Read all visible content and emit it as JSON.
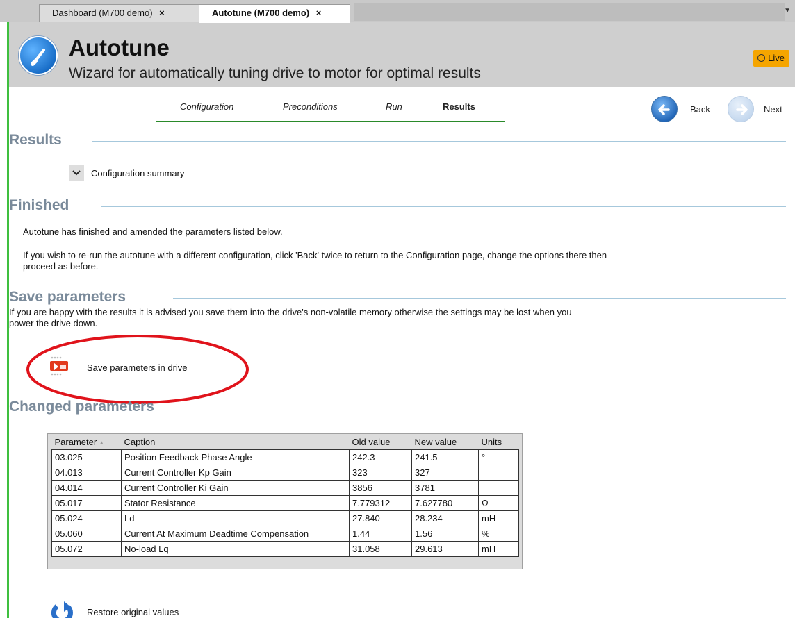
{
  "tabs": [
    {
      "label": "Dashboard (M700 demo)",
      "close": "×",
      "active": false
    },
    {
      "label": "Autotune (M700 demo)",
      "close": "×",
      "active": true
    }
  ],
  "header": {
    "title": "Autotune",
    "subtitle": "Wizard for automatically tuning drive to motor for optimal results",
    "live_label": "Live",
    "live_color": "#f5a500"
  },
  "wizard": {
    "steps": [
      "Configuration",
      "Preconditions",
      "Run",
      "Results"
    ],
    "current_step": "Results",
    "back_label": "Back",
    "next_label": "Next"
  },
  "results": {
    "heading": "Results",
    "config_summary_label": "Configuration summary"
  },
  "finished": {
    "heading": "Finished",
    "line1": "Autotune has finished and amended the parameters listed below.",
    "line2a": "If you wish to re-run the autotune with a different configuration, click 'Back' twice to return to the Configuration page, change the options there then",
    "line2b": "proceed as before."
  },
  "save": {
    "heading": "Save parameters",
    "desc_a": "If you are happy with the results it is advised you save them into the drive's non-volatile memory otherwise the settings may be lost when you",
    "desc_b": "power the drive down.",
    "button_label": "Save parameters in drive",
    "highlight_color": "#e0131b"
  },
  "changed": {
    "heading": "Changed parameters",
    "columns": [
      "Parameter",
      "Caption",
      "Old value",
      "New value",
      "Units"
    ],
    "rows": [
      [
        "03.025",
        "Position Feedback Phase Angle",
        "242.3",
        "241.5",
        "°"
      ],
      [
        "04.013",
        "Current Controller Kp Gain",
        "323",
        "327",
        ""
      ],
      [
        "04.014",
        "Current Controller Ki Gain",
        "3856",
        "3781",
        ""
      ],
      [
        "05.017",
        "Stator Resistance",
        "7.779312",
        "7.627780",
        "Ω"
      ],
      [
        "05.024",
        "Ld",
        "27.840",
        "28.234",
        "mH"
      ],
      [
        "05.060",
        "Current At Maximum Deadtime Compensation",
        "1.44",
        "1.56",
        "%"
      ],
      [
        "05.072",
        "No-load Lq",
        "31.058",
        "29.613",
        "mH"
      ]
    ],
    "restore_label": "Restore original values"
  }
}
